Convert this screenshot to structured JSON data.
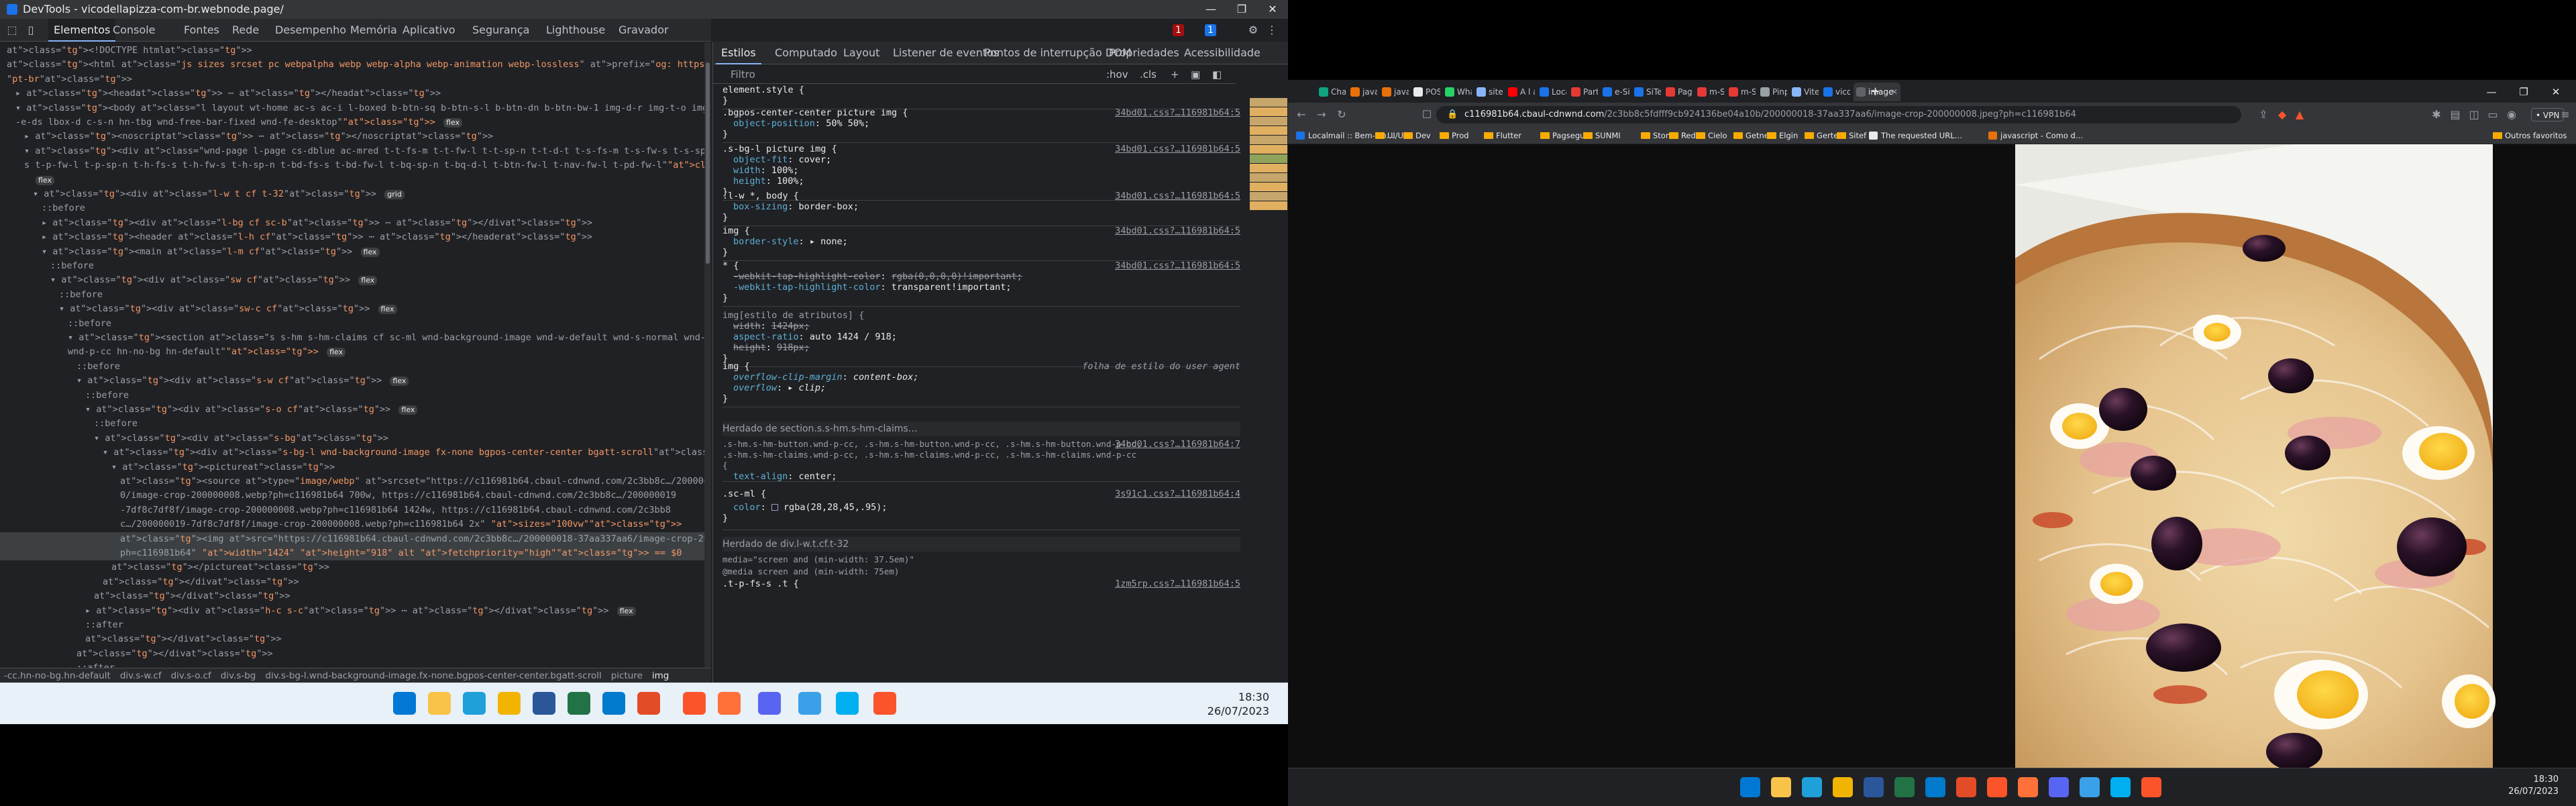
{
  "devtools": {
    "window_title": "DevTools - vicodellapizza-com-br.webnode.page/",
    "tabs": [
      "Elementos",
      "Console",
      "Fontes",
      "Rede",
      "Desempenho",
      "Memória",
      "Aplicativo",
      "Segurança",
      "Lighthouse",
      "Gravador"
    ],
    "active_tab": "Elementos",
    "error_count": "1",
    "message_count": "1",
    "dom_lines": [
      {
        "indent": 0,
        "html": "<!DOCTYPE html>"
      },
      {
        "indent": 0,
        "html": "<html class=\"js sizes srcset pc webpalpha webp webp-alpha webp-animation webp-lossless\" prefix=\"og: https://ogp.me/ns#\" lang="
      },
      {
        "indent": 0,
        "html": "\"pt-br\">"
      },
      {
        "indent": 1,
        "html": "▸ <head> ⋯ </head>"
      },
      {
        "indent": 1,
        "html": "▾ <body class=\"l layout wt-home ac-s ac-i l-boxed b-btn-sq b-btn-s-l b-btn-dn b-btn-bw-1 img-d-r img-t-o img-h-z line-solid b"
      },
      {
        "indent": 1,
        "html": "  -e-ds lbox-d c-s-n hn-tbg wnd-free-bar-fixed wnd-fe-desktop\"> flex"
      },
      {
        "indent": 2,
        "html": "▸ <noscript> ⋯ </noscript>"
      },
      {
        "indent": 2,
        "html": "▾ <div class=\"wnd-page l-page cs-dblue ac-mred t-t-fs-m t-t-fw-l t-t-sp-n t-t-d-t t-s-fs-m t-s-fw-s t-s-sp-n t-s-d-n t-p-fs-"
      },
      {
        "indent": 2,
        "html": "  s t-p-fw-l t-p-sp-n t-h-fs-s t-h-fw-s t-h-sp-n t-bd-fs-s t-bd-fw-l t-bq-sp-n t-bq-d-l t-btn-fw-l t-nav-fw-l t-pd-fw-l\">"
      },
      {
        "indent": 3,
        "html": "flex"
      },
      {
        "indent": 3,
        "html": "▾ <div class=\"l-w t cf t-32\"> grid"
      },
      {
        "indent": 4,
        "html": "::before"
      },
      {
        "indent": 4,
        "html": "▸ <div class=\"l-bg cf sc-b\"> ⋯ </div>"
      },
      {
        "indent": 4,
        "html": "▸ <header class=\"l-h cf\"> ⋯ </header>"
      },
      {
        "indent": 4,
        "html": "▾ <main class=\"l-m cf\"> flex"
      },
      {
        "indent": 5,
        "html": "::before"
      },
      {
        "indent": 5,
        "html": "▾ <div class=\"sw cf\"> flex"
      },
      {
        "indent": 6,
        "html": "::before"
      },
      {
        "indent": 6,
        "html": "▾ <div class=\"sw-c cf\"> flex"
      },
      {
        "indent": 7,
        "html": "::before"
      },
      {
        "indent": 7,
        "html": "▾ <section class=\"s s-hm s-hm-claims cf sc-ml wnd-background-image  wnd-w-default wnd-s-normal wnd-h-full wnd-nh-m"
      },
      {
        "indent": 7,
        "html": "  wnd-p-cc hn-no-bg hn-default\"> flex"
      },
      {
        "indent": 8,
        "html": "::before"
      },
      {
        "indent": 8,
        "html": "▾ <div class=\"s-w cf\"> flex"
      },
      {
        "indent": 9,
        "html": "::before"
      },
      {
        "indent": 9,
        "html": "▾ <div class=\"s-o cf\"> flex"
      },
      {
        "indent": 10,
        "html": "::before"
      },
      {
        "indent": 10,
        "html": "▾ <div class=\"s-bg\">"
      },
      {
        "indent": 11,
        "html": "▾ <div class=\"s-bg-l wnd-background-image fx-none bgpos-center-center bgatt-scroll\">"
      },
      {
        "indent": 12,
        "html": "▾ <picture>"
      },
      {
        "indent": 13,
        "html": "<source type=\"image/webp\" srcset=\"https://c116981b64.cbaul-cdnwnd.com/2c3bb8c…/200000019-7df8c7df8f/70"
      },
      {
        "indent": 13,
        "html": "0/image-crop-200000008.webp?ph=c116981b64 700w, https://c116981b64.cbaul-cdnwnd.com/2c3bb8c…/200000019"
      },
      {
        "indent": 13,
        "html": "-7df8c7df8f/image-crop-200000008.webp?ph=c116981b64 1424w, https://c116981b64.cbaul-cdnwnd.com/2c3bb8"
      },
      {
        "indent": 13,
        "html": "c…/200000019-7df8c7df8f/image-crop-200000008.webp?ph=c116981b64 2x\" sizes=\"100vw\">"
      },
      {
        "indent": 13,
        "html": "<img src=\"https://c116981b64.cbaul-cdnwnd.com/2c3bb8c…/200000018-37aa337aa6/image-crop-200000008.jpeg?"
      },
      {
        "indent": 13,
        "html": "ph=c116981b64\" width=\"1424\" height=\"918\" alt fetchpriority=\"high\"> == $0"
      },
      {
        "indent": 12,
        "html": "</picture>"
      },
      {
        "indent": 11,
        "html": "</div>"
      },
      {
        "indent": 10,
        "html": "</div>"
      },
      {
        "indent": 9,
        "html": "▸ <div class=\"h-c s-c\"> ⋯ </div> flex"
      },
      {
        "indent": 9,
        "html": "::after"
      },
      {
        "indent": 9,
        "html": "</div>"
      },
      {
        "indent": 8,
        "html": "</div>"
      },
      {
        "indent": 8,
        "html": "::after"
      }
    ],
    "breadcrumbs": [
      "-cc.hn-no-bg.hn-default",
      "div.s-w.cf",
      "div.s-o.cf",
      "div.s-bg",
      "div.s-bg-l.wnd-background-image.fx-none.bgpos-center-center.bgatt-scroll",
      "picture",
      "img"
    ],
    "styles_tabs": [
      "Estilos",
      "Computado",
      "Layout",
      "Listener de eventos",
      "Pontos de interrupção DOM",
      "Propriedades",
      "Acessibilidade"
    ],
    "filter_placeholder": "Filtro",
    "filter_hov": ":hov",
    "filter_cls": ".cls",
    "rules": [
      {
        "selector": "element.style {",
        "source": "",
        "props": [],
        "close": "}"
      },
      {
        "selector": ".bgpos-center-center picture img {",
        "source": "34bd01.css?…116981b64:5",
        "props": [
          [
            "object-position",
            "50% 50%;",
            false
          ]
        ],
        "close": "}"
      },
      {
        "selector": ".s-bg-l picture img {",
        "source": "34bd01.css?…116981b64:5",
        "props": [
          [
            "object-fit",
            "cover;",
            false
          ],
          [
            "width",
            "100%;",
            false
          ],
          [
            "height",
            "100%;",
            false
          ]
        ],
        "close": "}"
      },
      {
        "selector": ".l-w *, body {",
        "source": "34bd01.css?…116981b64:5",
        "props": [
          [
            "box-sizing",
            "border-box;",
            false
          ]
        ],
        "close": "}"
      },
      {
        "selector": "img {",
        "source": "34bd01.css?…116981b64:5",
        "props": [
          [
            "border-style",
            "▸ none;",
            false
          ]
        ],
        "close": "}"
      },
      {
        "selector": "* {",
        "source": "34bd01.css?…116981b64:5",
        "props": [
          [
            "-webkit-tap-highlight-color",
            "rgba(0,0,0,0)!important;",
            true
          ],
          [
            "-webkit-tap-highlight-color",
            "transparent!important;",
            false
          ]
        ],
        "close": "}"
      },
      {
        "selector": "img[estilo de atributos] {",
        "source": "",
        "props": [
          [
            "width",
            "1424px;",
            true
          ],
          [
            "aspect-ratio",
            "auto 1424 / 918;",
            false
          ],
          [
            "height",
            "918px;",
            true
          ]
        ],
        "close": "}"
      },
      {
        "selector": "img {",
        "source": "folha de estilo do user agent",
        "props": [
          [
            "overflow-clip-margin",
            "content-box;",
            false
          ],
          [
            "overflow",
            "▸ clip;",
            false
          ]
        ],
        "close": "}"
      }
    ],
    "inherited_1": "Herdado de section.s.s-hm.s-hm-claims…",
    "rule_inherited_selector": ".s-hm.s-hm-button.wnd-p-cc, .s-hm.s-hm-button.wnd-p-cc, .s-hm.s-hm-button.wnd-p-cc, .s-hm.s-hm-claims.wnd-p-cc, .s-hm.s-hm-claims.wnd-p-cc, .s-hm.s-hm-claims.wnd-p-cc {",
    "rule_inherited_source": "34bd01.css?…116981b64:7",
    "rule_inherited_prop": [
      "text-align",
      "center;"
    ],
    "rule_sml_selector": ".sc-ml {",
    "rule_sml_source": "3s91c1.css?…116981b64:4",
    "rule_sml_prop": [
      "color",
      "rgba(28,28,45,.95);"
    ],
    "inherited_2": "Herdado de div.l-w.t.cf.t-32",
    "media_1": "media=\"screen and (min-width: 37.5em)\"",
    "media_2": "@media screen and (min-width: 75em)",
    "media_3": ".t-p-fs-s .t {",
    "media_source": "1zm5rp.css?…116981b64:5"
  },
  "left_taskbar": {
    "time": "18:30",
    "date": "26/07/2023"
  },
  "browser": {
    "tabs": [
      {
        "label": "ChatGPT",
        "color": "#10a37f"
      },
      {
        "label": "java - Mi…",
        "color": "#e8710a"
      },
      {
        "label": "javascript…",
        "color": "#e8710a"
      },
      {
        "label": "POS_Anci…",
        "color": "#e8eaed"
      },
      {
        "label": "WhatsApp",
        "color": "#25d366"
      },
      {
        "label": "site# - Pe…",
        "color": "#8ab4f8"
      },
      {
        "label": "A l a n W…",
        "color": "#ff0000"
      },
      {
        "label": "Localmail…",
        "color": "#1a73e8"
      },
      {
        "label": "Partner H…",
        "color": "#e53935"
      },
      {
        "label": "e-Sitef - L…",
        "color": "#1a73e8"
      },
      {
        "label": "SiTef",
        "color": "#1a73e8"
      },
      {
        "label": "Pagamen…",
        "color": "#e53935"
      },
      {
        "label": "m-SiTef |",
        "color": "#e53935"
      },
      {
        "label": "m-SiTef |",
        "color": "#e53935"
      },
      {
        "label": "Pinpad -…",
        "color": "#9aa0a6"
      },
      {
        "label": "Vite + Re…",
        "color": "#8ab4f8"
      },
      {
        "label": "vicodella…",
        "color": "#1a73e8"
      },
      {
        "label": "image",
        "color": "#5f6368"
      }
    ],
    "url_host": "c116981b64.cbaul-cdnwnd.com",
    "url_path": "/2c3bb8c5fdfff9cb924136be04a10b/200000018-37aa337aa6/image-crop-200000008.jpeg?ph=c116981b64",
    "vpn": "• VPN",
    "bookmarks": [
      {
        "label": "Localmail :: Bem-vin…",
        "kind": "fav",
        "color": "#1a73e8"
      },
      {
        "label": "UI/UX",
        "kind": "folder"
      },
      {
        "label": "Dev",
        "kind": "folder"
      },
      {
        "label": "Prod",
        "kind": "folder"
      },
      {
        "label": "Flutter",
        "kind": "folder"
      },
      {
        "label": "Pagseguro",
        "kind": "folder"
      },
      {
        "label": "SUNMI",
        "kind": "folder"
      },
      {
        "label": "Stone",
        "kind": "folder"
      },
      {
        "label": "Rede",
        "kind": "folder"
      },
      {
        "label": "Cielo",
        "kind": "folder"
      },
      {
        "label": "Getnet",
        "kind": "folder"
      },
      {
        "label": "Elgin",
        "kind": "folder"
      },
      {
        "label": "Gertec",
        "kind": "folder"
      },
      {
        "label": "Sitef",
        "kind": "folder"
      },
      {
        "label": "The requested URL…",
        "kind": "fav",
        "color": "#e8eaed"
      },
      {
        "label": "javascript - Como d…",
        "kind": "fav",
        "color": "#e8710a"
      }
    ],
    "other_bookmarks": "Outros favoritos"
  },
  "right_taskbar": {
    "time": "18:30",
    "date": "26/07/2023"
  },
  "colors": {
    "devtools_bg": "#202124",
    "tag": "#5db0d7",
    "attr": "#9bbbdc",
    "value": "#f29766",
    "accent": "#8ab4f8"
  }
}
